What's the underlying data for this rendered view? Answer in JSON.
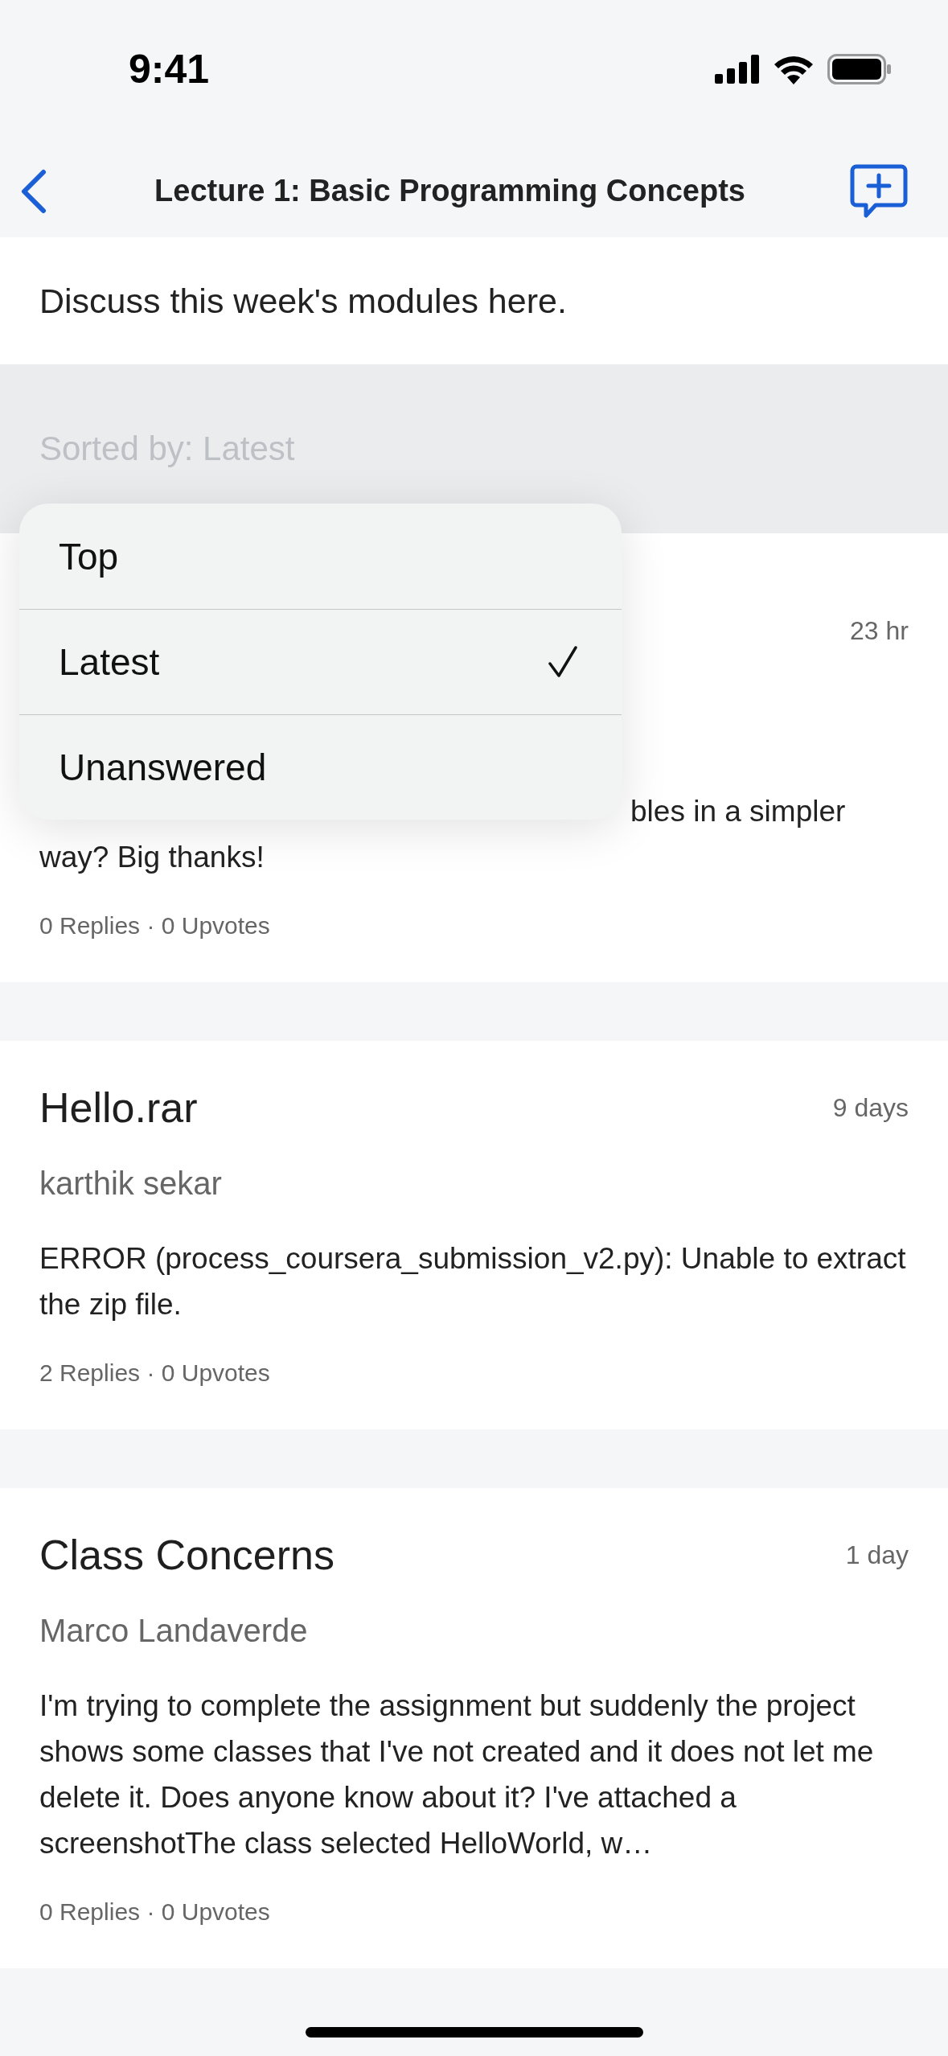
{
  "status_bar": {
    "time": "9:41"
  },
  "nav": {
    "title": "Lecture 1: Basic Programming Concepts"
  },
  "description": "Discuss this week's modules here.",
  "sort": {
    "label": "Sorted by: Latest",
    "options": [
      {
        "label": "Top",
        "selected": false
      },
      {
        "label": "Latest",
        "selected": true
      },
      {
        "label": "Unanswered",
        "selected": false
      }
    ]
  },
  "posts": [
    {
      "kind": "obscured",
      "time": "23 hr",
      "body_lines": [
        "bles in a simpler",
        "way? Big thanks!"
      ],
      "meta": "0 Replies · 0 Upvotes"
    },
    {
      "kind": "full",
      "title": "Hello.rar",
      "time": "9 days",
      "author": "karthik sekar",
      "body": "ERROR (process_coursera_submission_v2.py): Unable to extract the zip file.",
      "meta": "2 Replies · 0 Upvotes"
    },
    {
      "kind": "full",
      "title": "Class Concerns",
      "time": "1 day",
      "author": "Marco Landaverde",
      "body": "I'm trying to complete the assignment but suddenly the project shows some classes that I've not created and it does not let me delete it. Does anyone know about it? I've attached a screenshotThe class selected HelloWorld, w…",
      "meta": "0 Replies · 0 Upvotes"
    }
  ]
}
